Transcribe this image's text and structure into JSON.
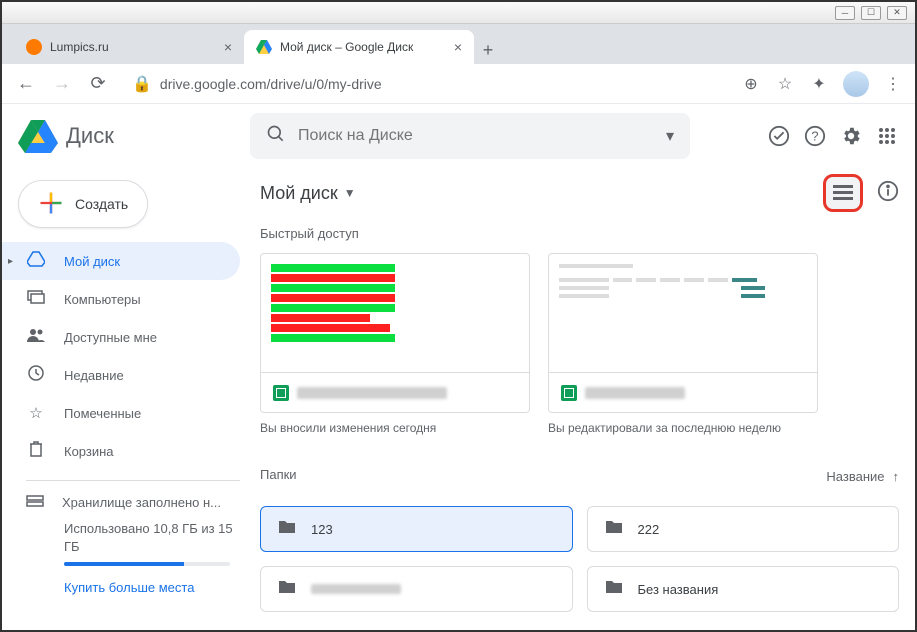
{
  "tabs": [
    {
      "title": "Lumpics.ru",
      "active": false
    },
    {
      "title": "Мой диск – Google Диск",
      "active": true
    }
  ],
  "url": "drive.google.com/drive/u/0/my-drive",
  "app": {
    "name": "Диск"
  },
  "search": {
    "placeholder": "Поиск на Диске"
  },
  "create_label": "Создать",
  "nav": [
    {
      "label": "Мой диск",
      "icon": "drive-icon",
      "active": true,
      "expandable": true
    },
    {
      "label": "Компьютеры",
      "icon": "computers-icon"
    },
    {
      "label": "Доступные мне",
      "icon": "shared-icon"
    },
    {
      "label": "Недавние",
      "icon": "recent-icon"
    },
    {
      "label": "Помеченные",
      "icon": "starred-icon"
    },
    {
      "label": "Корзина",
      "icon": "trash-icon"
    }
  ],
  "storage": {
    "title": "Хранилище заполнено н...",
    "detail": "Использовано 10,8 ГБ из 15 ГБ",
    "buy": "Купить больше места"
  },
  "path": "Мой диск",
  "quick": {
    "title": "Быстрый доступ",
    "items": [
      {
        "subtitle": "Вы вносили изменения сегодня"
      },
      {
        "subtitle": "Вы редактировали за последнюю неделю"
      }
    ]
  },
  "folders": {
    "title": "Папки",
    "sort_label": "Название",
    "items": [
      {
        "name": "123",
        "selected": true
      },
      {
        "name": "222"
      },
      {
        "name": "",
        "blurred": true
      },
      {
        "name": "Без названия"
      }
    ]
  }
}
